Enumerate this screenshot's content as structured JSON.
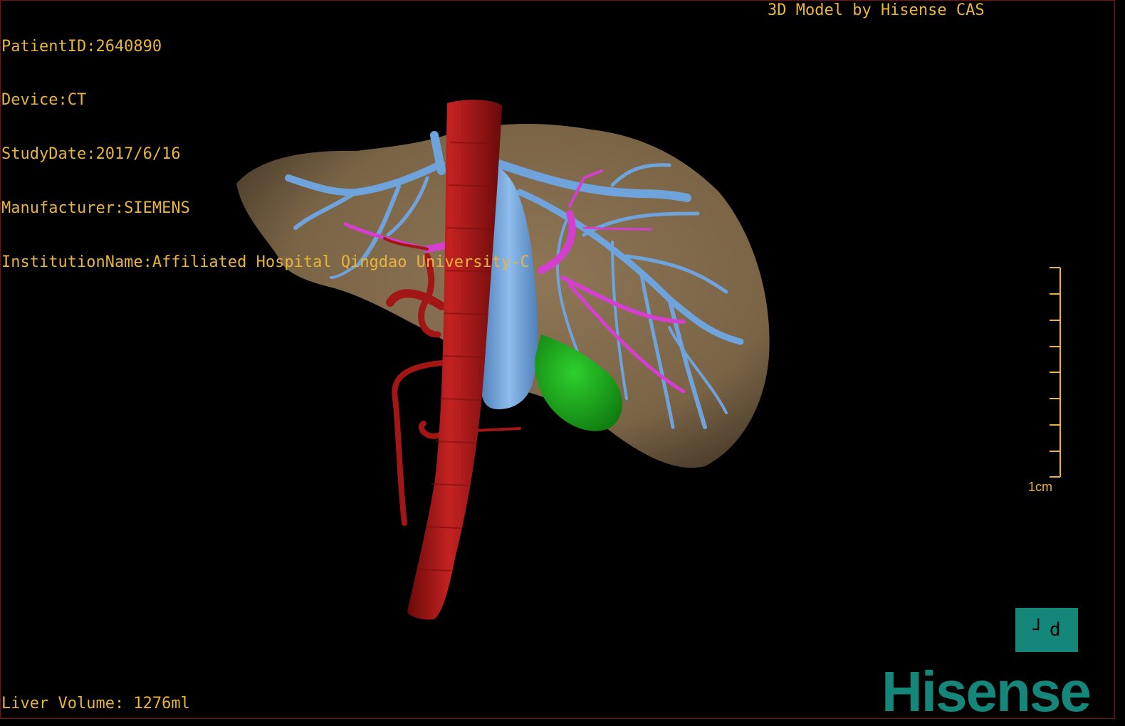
{
  "header": {
    "patient_id": "PatientID:2640890",
    "device": "Device:CT",
    "study_date": "StudyDate:2017/6/16",
    "manufacturer": "Manufacturer:SIEMENS",
    "institution": "InstitutionName:Affiliated Hospital Qingdao University-C"
  },
  "credit": "3D Model by Hisense CAS",
  "footer": {
    "liver_volume": "Liver Volume: 1276ml"
  },
  "scale_bar": {
    "label": "1cm"
  },
  "orientation_widget": {
    "left_glyph": "┘",
    "right_glyph": "d"
  },
  "brand": {
    "logo_text": "Hisense"
  },
  "colors": {
    "text": "#e8b43a",
    "liver": "#8a7050",
    "hepatic_vein": "#6fa3dc",
    "portal_vein": "#d43fd0",
    "artery": "#b01a1a",
    "gallbladder": "#1fa31f",
    "brand": "#15867a"
  }
}
